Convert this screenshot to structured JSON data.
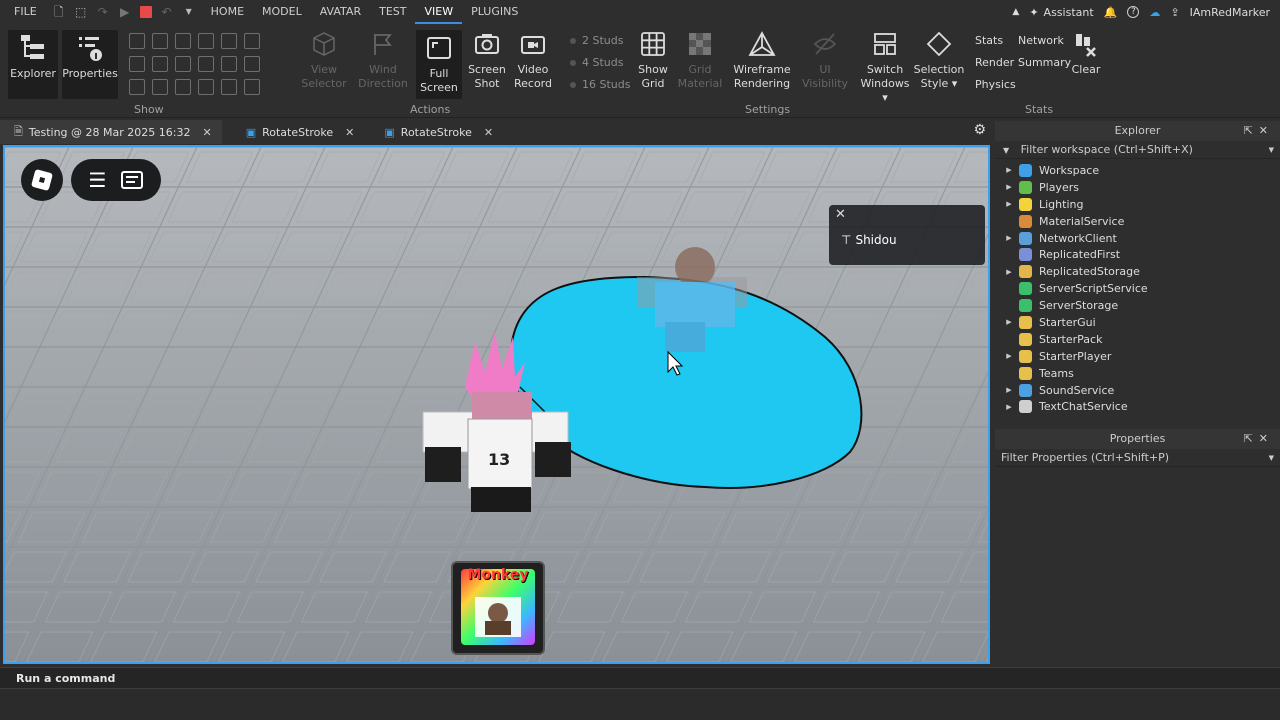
{
  "menu": {
    "file": "FILE",
    "tabs": [
      "HOME",
      "MODEL",
      "AVATAR",
      "TEST",
      "VIEW",
      "PLUGINS"
    ],
    "active_tab": "VIEW",
    "assistant": "Assistant",
    "username": "IAmRedMarker"
  },
  "ribbon": {
    "explorer": "Explorer",
    "properties": "Properties",
    "show_group": "Show",
    "view_selector": [
      "View",
      "Selector"
    ],
    "wind_direction": [
      "Wind",
      "Direction"
    ],
    "full_screen": [
      "Full",
      "Screen"
    ],
    "screen_shot": [
      "Screen",
      "Shot"
    ],
    "video_record": [
      "Video",
      "Record"
    ],
    "actions_group": "Actions",
    "studs": [
      "2 Studs",
      "4 Studs",
      "16 Studs"
    ],
    "show_grid": [
      "Show",
      "Grid"
    ],
    "grid_material": [
      "Grid",
      "Material"
    ],
    "wireframe": [
      "Wireframe",
      "Rendering"
    ],
    "ui_visibility": "UI Visibility",
    "switch_windows": [
      "Switch",
      "Windows ▾"
    ],
    "selection_style": [
      "Selection",
      "Style ▾"
    ],
    "settings_group": "Settings",
    "stats_items": [
      "Stats",
      "Network",
      "Render",
      "Summary",
      "Physics"
    ],
    "clear": "Clear",
    "stats_group": "Stats"
  },
  "tabs": [
    {
      "label": "Testing @ 28 Mar 2025 16:32",
      "active": true
    },
    {
      "label": "RotateStroke",
      "active": false
    },
    {
      "label": "RotateStroke",
      "active": false
    }
  ],
  "viewport": {
    "notification_name": "Shidou",
    "hotbar_label": "Monkey",
    "jersey_number": "13"
  },
  "explorer": {
    "title": "Explorer",
    "filter_placeholder": "Filter workspace (Ctrl+Shift+X)",
    "items": [
      {
        "label": "Workspace",
        "expandable": true,
        "color": "#3fa0e8"
      },
      {
        "label": "Players",
        "expandable": true,
        "color": "#5fbf4a"
      },
      {
        "label": "Lighting",
        "expandable": true,
        "color": "#f2d33a"
      },
      {
        "label": "MaterialService",
        "expandable": false,
        "color": "#d98a3a"
      },
      {
        "label": "NetworkClient",
        "expandable": true,
        "color": "#5aa0d8"
      },
      {
        "label": "ReplicatedFirst",
        "expandable": false,
        "color": "#7b8fd9"
      },
      {
        "label": "ReplicatedStorage",
        "expandable": true,
        "color": "#e2b64a"
      },
      {
        "label": "ServerScriptService",
        "expandable": false,
        "color": "#3cbf6a"
      },
      {
        "label": "ServerStorage",
        "expandable": false,
        "color": "#3cbf6a"
      },
      {
        "label": "StarterGui",
        "expandable": true,
        "color": "#e6c04a"
      },
      {
        "label": "StarterPack",
        "expandable": false,
        "color": "#e6c04a"
      },
      {
        "label": "StarterPlayer",
        "expandable": true,
        "color": "#e6c04a"
      },
      {
        "label": "Teams",
        "expandable": false,
        "color": "#e6c04a"
      },
      {
        "label": "SoundService",
        "expandable": true,
        "color": "#4aa0e0"
      },
      {
        "label": "TextChatService",
        "expandable": true,
        "color": "#cfcfcf"
      }
    ]
  },
  "properties": {
    "title": "Properties",
    "filter_placeholder": "Filter Properties (Ctrl+Shift+P)"
  },
  "command_bar": {
    "placeholder": "Run a command"
  }
}
